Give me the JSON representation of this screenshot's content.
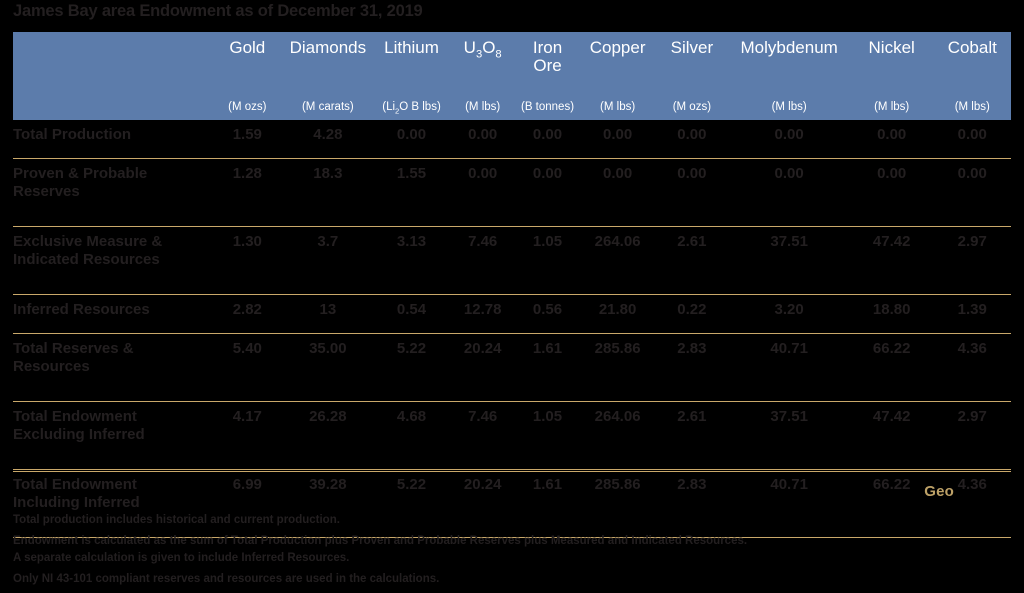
{
  "title": "James Bay area Endowment as of December 31, 2019",
  "colors": {
    "header_blue": "#5c7cab",
    "rule_gold": "#c9a86a",
    "text_dark": "#231f20",
    "accent_gold": "#bda167",
    "background": "#000000"
  },
  "table": {
    "label_column_header": "",
    "columns": [
      {
        "name": "Gold",
        "unit": "(M ozs)"
      },
      {
        "name": "Diamonds",
        "unit": "(M carats)"
      },
      {
        "name": "Lithium",
        "unit": "(Li2O B lbs)"
      },
      {
        "name": "U3O8",
        "unit": "(M lbs)"
      },
      {
        "name": "Iron\nOre",
        "unit": "(B tonnes)"
      },
      {
        "name": "Copper",
        "unit": "(M lbs)"
      },
      {
        "name": "Silver",
        "unit": "(M ozs)"
      },
      {
        "name": "Molybdenum",
        "unit": "(M lbs)"
      },
      {
        "name": "Nickel",
        "unit": "(M lbs)"
      },
      {
        "name": "Cobalt",
        "unit": "(M lbs)"
      }
    ],
    "rows": [
      {
        "label": "Total Production",
        "lines": 1,
        "values": [
          "1.59",
          "4.28",
          "0.00",
          "0.00",
          "0.00",
          "0.00",
          "0.00",
          "0.00",
          "0.00",
          "0.00"
        ]
      },
      {
        "label": "Proven & Probable\nReserves",
        "lines": 2,
        "values": [
          "1.28",
          "18.3",
          "1.55",
          "0.00",
          "0.00",
          "0.00",
          "0.00",
          "0.00",
          "0.00",
          "0.00"
        ]
      },
      {
        "label": "Exclusive Measure &\nIndicated Resources",
        "lines": 2,
        "values": [
          "1.30",
          "3.7",
          "3.13",
          "7.46",
          "1.05",
          "264.06",
          "2.61",
          "37.51",
          "47.42",
          "2.97"
        ]
      },
      {
        "label": "Inferred Resources",
        "lines": 1,
        "values": [
          "2.82",
          "13",
          "0.54",
          "12.78",
          "0.56",
          "21.80",
          "0.22",
          "3.20",
          "18.80",
          "1.39"
        ]
      },
      {
        "label": "Total Reserves &\nResources",
        "lines": 2,
        "values": [
          "5.40",
          "35.00",
          "5.22",
          "20.24",
          "1.61",
          "285.86",
          "2.83",
          "40.71",
          "66.22",
          "4.36"
        ]
      },
      {
        "label": "Total Endowment\nExcluding Inferred",
        "lines": 2,
        "values": [
          "4.17",
          "26.28",
          "4.68",
          "7.46",
          "1.05",
          "264.06",
          "2.61",
          "37.51",
          "47.42",
          "2.97"
        ]
      },
      {
        "label": "Total Endowment\nIncluding Inferred",
        "lines": 2,
        "values": [
          "6.99",
          "39.28",
          "5.22",
          "20.24",
          "1.61",
          "285.86",
          "2.83",
          "40.71",
          "66.22",
          "4.36"
        ]
      }
    ]
  },
  "footer_mark": {
    "text": "Geo"
  },
  "notes": [
    "Total production includes historical and current production.",
    "Endowment is calculated as the sum of Total Production plus Proven and Probable Reserves plus Measured and Indicated Resources.\nA separate calculation is given to include Inferred Resources.",
    "Only NI 43-101 compliant reserves and resources are used in the calculations."
  ]
}
